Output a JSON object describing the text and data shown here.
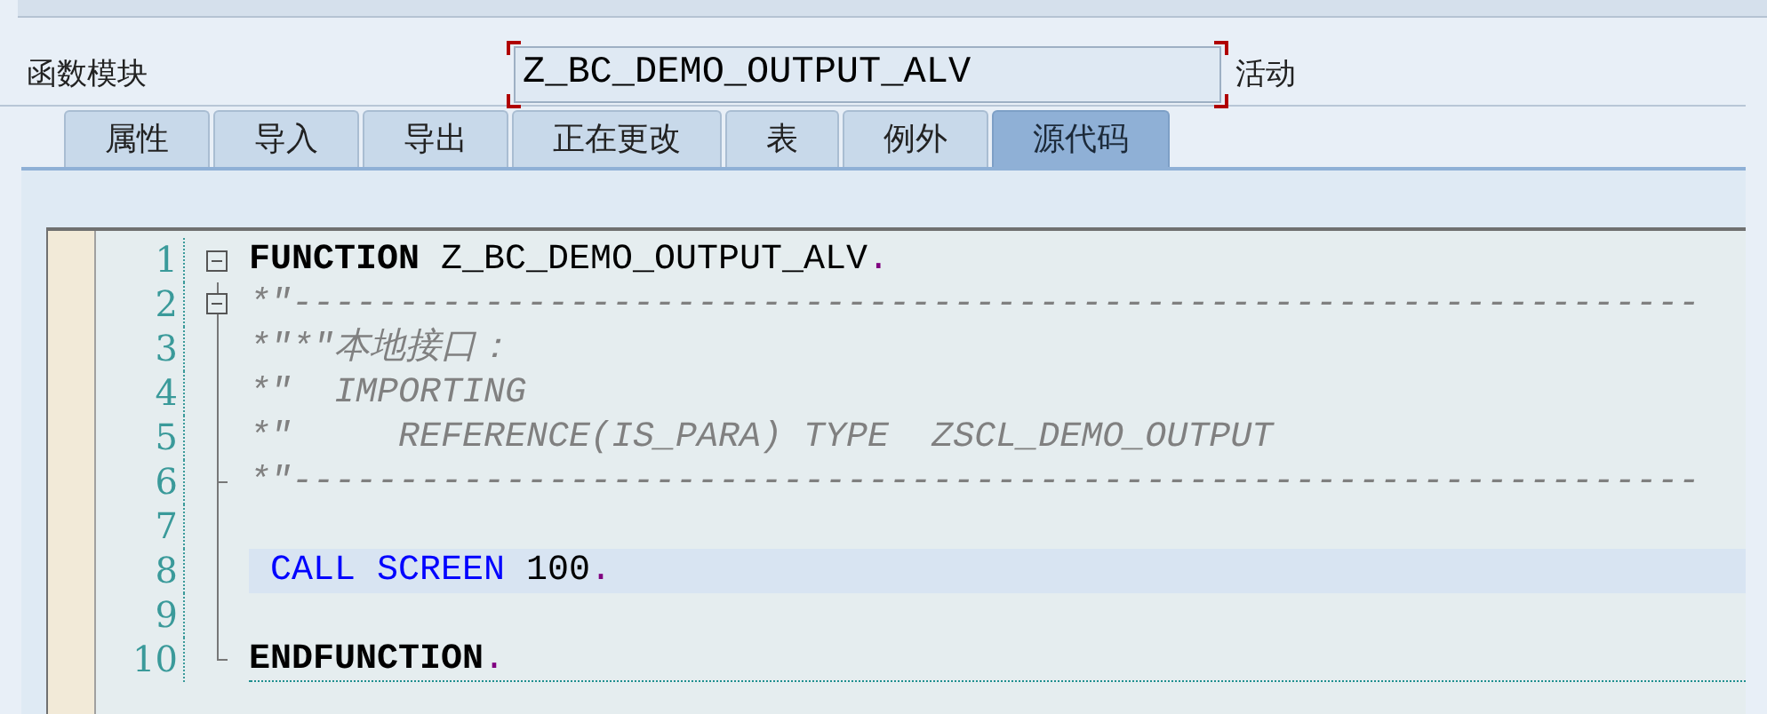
{
  "header": {
    "label": "函数模块",
    "field_value": "Z_BC_DEMO_OUTPUT_ALV",
    "status": "活动"
  },
  "tabs": [
    {
      "label": "属性",
      "selected": false
    },
    {
      "label": "导入",
      "selected": false
    },
    {
      "label": "导出",
      "selected": false
    },
    {
      "label": "正在更改",
      "selected": false
    },
    {
      "label": "表",
      "selected": false
    },
    {
      "label": "例外",
      "selected": false
    },
    {
      "label": "源代码",
      "selected": true
    }
  ],
  "editor": {
    "lines": [
      {
        "number": "1",
        "collapsible": true,
        "highlighted": false,
        "current": false,
        "tokens": [
          {
            "kind": "keyword",
            "text": "FUNCTION"
          },
          {
            "kind": "plain",
            "text": " Z_BC_DEMO_OUTPUT_ALV"
          },
          {
            "kind": "period",
            "text": "."
          }
        ]
      },
      {
        "number": "2",
        "collapsible": true,
        "highlighted": false,
        "current": false,
        "tokens": [
          {
            "kind": "comment",
            "text": "*\"------------------------------------------------------------------"
          }
        ]
      },
      {
        "number": "3",
        "collapsible": false,
        "highlighted": false,
        "current": false,
        "tokens": [
          {
            "kind": "comment",
            "text": "*\"*\"本地接口："
          }
        ]
      },
      {
        "number": "4",
        "collapsible": false,
        "highlighted": false,
        "current": false,
        "tokens": [
          {
            "kind": "comment",
            "text": "*\"  IMPORTING"
          }
        ]
      },
      {
        "number": "5",
        "collapsible": false,
        "highlighted": false,
        "current": false,
        "tokens": [
          {
            "kind": "comment",
            "text": "*\"     REFERENCE(IS_PARA) TYPE  ZSCL_DEMO_OUTPUT"
          }
        ]
      },
      {
        "number": "6",
        "collapsible": false,
        "highlighted": false,
        "current": false,
        "tokens": [
          {
            "kind": "comment",
            "text": "*\"------------------------------------------------------------------"
          }
        ]
      },
      {
        "number": "7",
        "collapsible": false
      },
      {
        "number": "8",
        "collapsible": false,
        "highlighted": true,
        "current": false,
        "tokens": [
          {
            "kind": "statement",
            "text": "CALL SCREEN"
          },
          {
            "kind": "plain",
            "text": " 100"
          },
          {
            "kind": "period",
            "text": "."
          }
        ]
      },
      {
        "number": "9",
        "collapsible": false
      },
      {
        "number": "10",
        "collapsible": false,
        "highlighted": false,
        "current": true,
        "tokens": [
          {
            "kind": "keyword",
            "text": "ENDFUNCTION"
          },
          {
            "kind": "period",
            "text": "."
          }
        ]
      }
    ]
  }
}
